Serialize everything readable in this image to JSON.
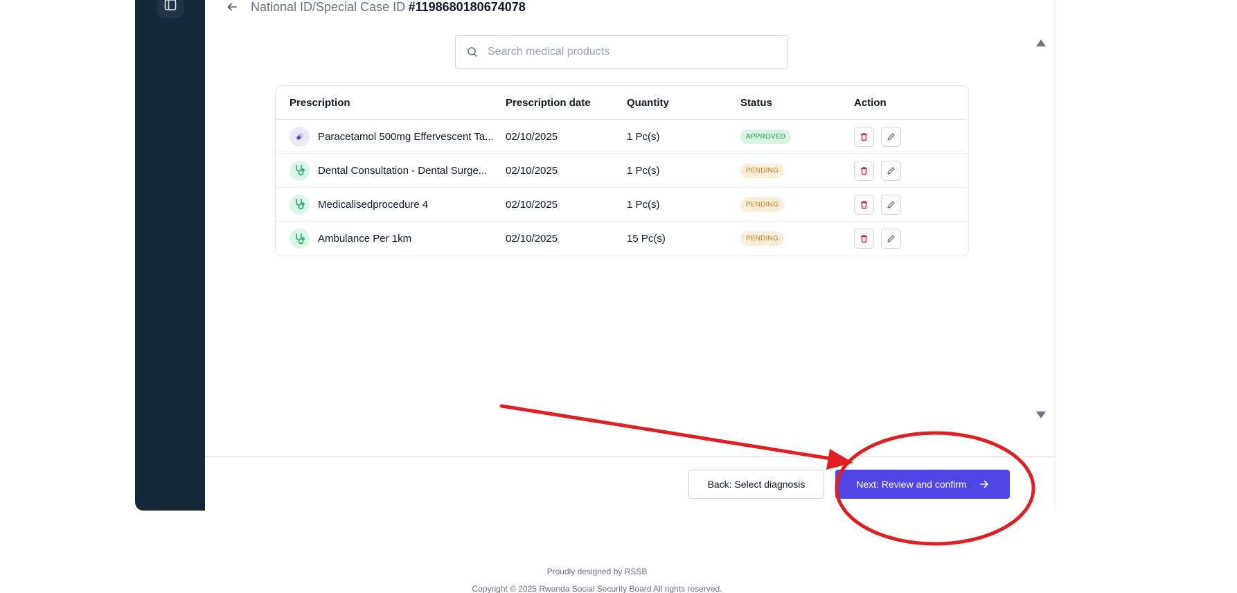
{
  "header": {
    "case_label": "National ID/Special Case ID",
    "case_id": "#1198680180674078"
  },
  "search": {
    "placeholder": "Search medical products"
  },
  "table": {
    "columns": [
      "Prescription",
      "Prescription date",
      "Quantity",
      "Status",
      "Action"
    ],
    "rows": [
      {
        "name": "Paracetamol 500mg Effervescent Ta...",
        "date": "02/10/2025",
        "quantity": "1 Pc(s)",
        "status": "APPROVED",
        "icon": "pill-icon"
      },
      {
        "name": "Dental Consultation - Dental Surge...",
        "date": "02/10/2025",
        "quantity": "1 Pc(s)",
        "status": "PENDING",
        "icon": "stethoscope-icon"
      },
      {
        "name": "Medicalisedprocedure 4",
        "date": "02/10/2025",
        "quantity": "1 Pc(s)",
        "status": "PENDING",
        "icon": "stethoscope-icon"
      },
      {
        "name": "Ambulance Per 1km",
        "date": "02/10/2025",
        "quantity": "15 Pc(s)",
        "status": "PENDING",
        "icon": "stethoscope-icon"
      }
    ]
  },
  "footer_bar": {
    "back_label": "Back: Select diagnosis",
    "next_label": "Next: Review and confirm"
  },
  "page_footer": {
    "credits": "Proudly designed by RSSB",
    "copyright": "Copyright © 2025 Rwanda Social Security Board All rights reserved."
  },
  "colors": {
    "sidebar": "#14293a",
    "primary": "#4f46e5",
    "annotation": "#e02020",
    "approved": "#1f9d55",
    "pending": "#c27a1d",
    "delete": "#dc2626"
  }
}
